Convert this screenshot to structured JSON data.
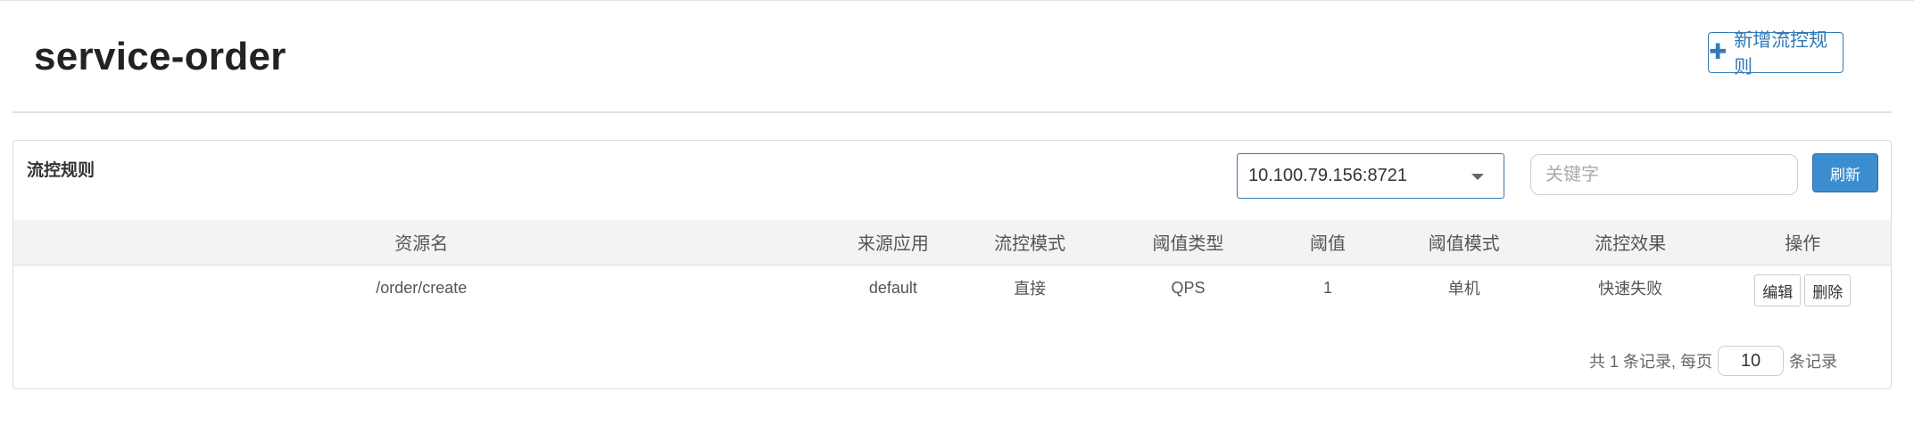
{
  "header": {
    "title": "service-order",
    "add_button_label": "新增流控规则",
    "add_button_icon": "plus-icon"
  },
  "panel": {
    "title": "流控规则",
    "machine_select": {
      "value": "10.100.79.156:8721"
    },
    "search": {
      "placeholder": "关键字",
      "value": ""
    },
    "refresh_label": "刷新"
  },
  "table": {
    "columns": [
      "资源名",
      "来源应用",
      "流控模式",
      "阈值类型",
      "阈值",
      "阈值模式",
      "流控效果",
      "操作"
    ],
    "rows": [
      {
        "resource": "/order/create",
        "limit_app": "default",
        "strategy": "直接",
        "grade": "QPS",
        "count": "1",
        "cluster_mode": "单机",
        "control_behavior": "快速失败",
        "edit_label": "编辑",
        "delete_label": "删除"
      }
    ]
  },
  "pagination": {
    "prefix": "共 1 条记录, 每页",
    "page_size": "10",
    "suffix": "条记录"
  },
  "colors": {
    "primary": "#337ab7",
    "refresh_bg": "#3c8dd0",
    "header_row_bg": "#f3f3f3"
  }
}
